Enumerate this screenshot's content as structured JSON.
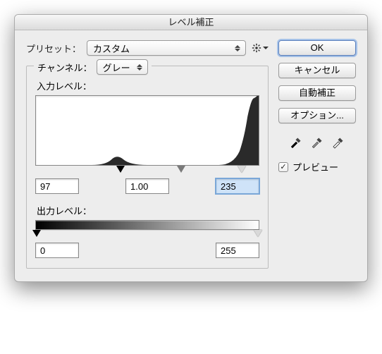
{
  "title": "レベル補正",
  "preset": {
    "label": "プリセット：",
    "value": "カスタム"
  },
  "channel": {
    "label": "チャンネル：",
    "value": "グレー"
  },
  "input_levels": {
    "label": "入力レベル：",
    "black": "97",
    "gamma": "1.00",
    "white": "235"
  },
  "output_levels": {
    "label": "出力レベル：",
    "black": "0",
    "white": "255"
  },
  "buttons": {
    "ok": "OK",
    "cancel": "キャンセル",
    "auto": "自動補正",
    "options": "オプション..."
  },
  "preview": {
    "label": "プレビュー",
    "checked": true
  }
}
